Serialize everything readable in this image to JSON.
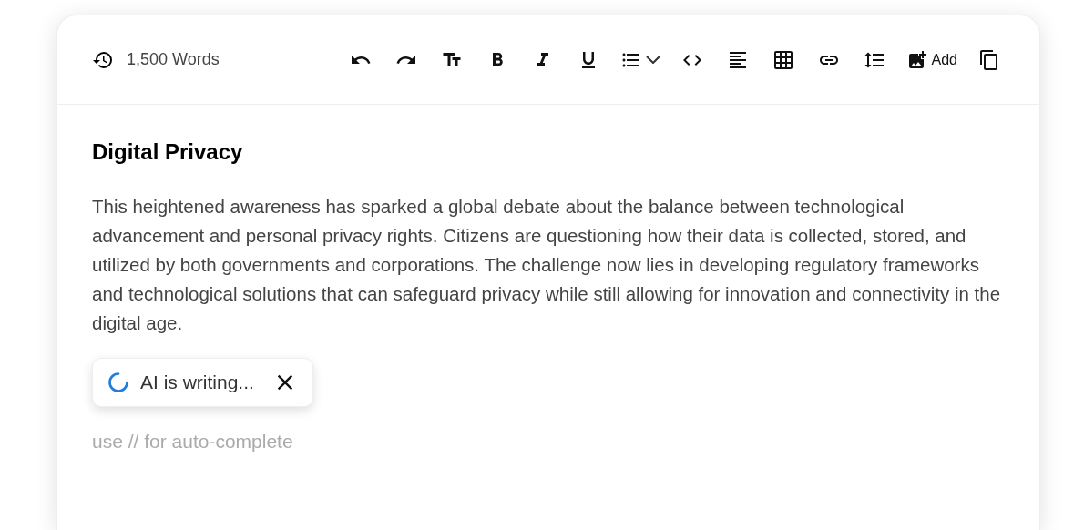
{
  "toolbar": {
    "word_count": "1,500 Words",
    "tools": [
      {
        "kind": "undo"
      },
      {
        "kind": "redo"
      },
      {
        "kind": "text-size"
      },
      {
        "kind": "bold"
      },
      {
        "kind": "italic"
      },
      {
        "kind": "underline"
      },
      {
        "kind": "list"
      },
      {
        "kind": "code"
      },
      {
        "kind": "align"
      },
      {
        "kind": "table"
      },
      {
        "kind": "link"
      },
      {
        "kind": "line-spacing"
      },
      {
        "kind": "image",
        "label": "Add"
      },
      {
        "kind": "copy"
      }
    ]
  },
  "document": {
    "heading": "Digital Privacy",
    "paragraph": "This heightened awareness has sparked a global debate about the balance between technological advancement and personal privacy rights. Citizens are questioning how their data is collected, stored, and utilized by both governments and corporations. The challenge now lies in developing regulatory frameworks and technological solutions that can safeguard privacy while still allowing for innovation and connectivity in the digital age."
  },
  "ai_status": {
    "label": "AI is writing..."
  },
  "input": {
    "placeholder": "use // for auto-complete"
  }
}
